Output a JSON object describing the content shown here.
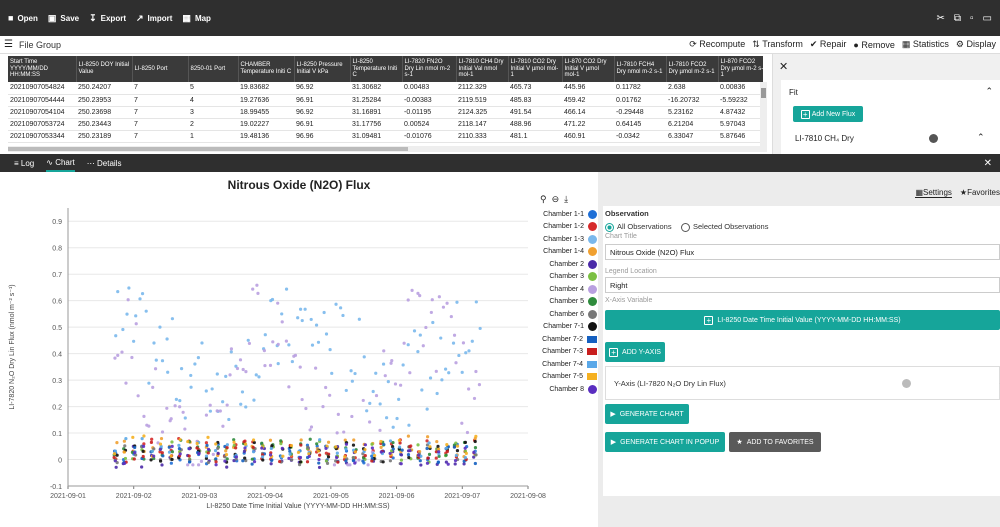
{
  "toolbar": {
    "open": "Open",
    "save": "Save",
    "export": "Export",
    "import": "Import",
    "map": "Map"
  },
  "filegroup": {
    "label": "File Group"
  },
  "actions": {
    "recompute": "Recompute",
    "transform": "Transform",
    "repair": "Repair",
    "remove": "Remove",
    "statistics": "Statistics",
    "display": "Display"
  },
  "table": {
    "headers": [
      "Start Time YYYY/MM/DD HH:MM:SS",
      "LI-8250 DOY Initial Value",
      "LI-8250 Port",
      "8250-01 Port",
      "CHAMBER Temperature Initi C",
      "LI-8250 Pressure Initial V kPa",
      "LI-8250 Temperature Initi C",
      "LI-7820 FN2O Dry Lin nmol m-2 s-1",
      "LI-7810 CH4 Dry Initial Val nmol mol-1",
      "LI-7810 CO2 Dry Initial V µmol mol-1",
      "LI-870 CO2 Dry Initial V µmol mol-1",
      "LI-7810 FCH4 Dry nmol m-2 s-1",
      "LI-7810 FCO2 Dry µmol m-2 s-1",
      "LI-870 FCO2 Dry µmol m-2 s-1"
    ],
    "rows": [
      [
        "20210907054824",
        "250.24207",
        "7",
        "5",
        "19.83682",
        "96.92",
        "31.30682",
        "0.00483",
        "2112.329",
        "465.73",
        "445.96",
        "0.11782",
        "2.638",
        "0.00836"
      ],
      [
        "20210907054444",
        "250.23953",
        "7",
        "4",
        "19.27636",
        "96.91",
        "31.25284",
        "-0.00383",
        "2119.519",
        "485.83",
        "459.42",
        "0.01762",
        "-16.20732",
        "-5.59232"
      ],
      [
        "20210907054104",
        "250.23698",
        "7",
        "3",
        "18.99455",
        "96.92",
        "31.16891",
        "-0.01195",
        "2124.325",
        "491.54",
        "466.14",
        "-0.29448",
        "5.23162",
        "4.87432"
      ],
      [
        "20210907053724",
        "250.23443",
        "7",
        "2",
        "19.02227",
        "96.91",
        "31.17756",
        "0.00524",
        "2118.147",
        "488.96",
        "471.22",
        "0.64145",
        "6.21204",
        "5.97043"
      ],
      [
        "20210907053344",
        "250.23189",
        "7",
        "1",
        "19.48136",
        "96.96",
        "31.09481",
        "-0.01076",
        "2110.333",
        "481.1",
        "460.91",
        "-0.0342",
        "6.33047",
        "5.87646"
      ]
    ]
  },
  "fit": {
    "label": "Fit",
    "add_new_flux": "Add New Flux",
    "flux_item": "LI-7810 CH₄ Dry"
  },
  "tabs": {
    "log": "Log",
    "chart": "Chart",
    "details": "Details"
  },
  "settings": {
    "settings_tab": "Settings",
    "favorites_tab": "Favorites",
    "observation_label": "Observation",
    "all_obs": "All Observations",
    "selected_obs": "Selected Observations",
    "chart_title_label": "Chart Title",
    "chart_title_value": "Nitrous Oxide (N2O) Flux",
    "legend_location_label": "Legend Location",
    "legend_location_value": "Right",
    "x_axis_label": "X-Axis Variable",
    "x_axis_value": "LI-8250 Date Time Initial Value (YYYY-MM-DD HH:MM:SS)",
    "add_y_axis": "ADD Y-AXIS",
    "y_axis_value": "Y-Axis (LI-7820 N₂O Dry Lin Flux)",
    "generate_chart": "GENERATE CHART",
    "generate_popup": "GENERATE CHART IN POPUP",
    "add_favorites": "ADD TO FAVORITES"
  },
  "chart_data": {
    "type": "scatter",
    "title": "Nitrous Oxide (N2O) Flux",
    "xlabel": "LI-8250 Date Time Initial Value (YYYY-MM-DD HH:MM:SS)",
    "ylabel": "LI-7820 N₂O Dry Lin Flux (nmol m⁻² s⁻¹)",
    "xticks": [
      "2021-09-01",
      "2021-09-02",
      "2021-09-03",
      "2021-09-04",
      "2021-09-05",
      "2021-09-06",
      "2021-09-07",
      "2021-09-08"
    ],
    "yticks": [
      "-0.1",
      "0",
      "0.1",
      "0.2",
      "0.3",
      "0.4",
      "0.5",
      "0.6",
      "0.7",
      "0.8",
      "0.9"
    ],
    "ylim": [
      -0.1,
      0.95
    ],
    "xlim": [
      0,
      7
    ],
    "legend_position": "right",
    "series": [
      {
        "name": "Chamber 1-1",
        "color": "#1f6fd6",
        "level": 0.02
      },
      {
        "name": "Chamber 1-2",
        "color": "#d62a2a",
        "level": 0.04
      },
      {
        "name": "Chamber 1-3",
        "color": "#7ab8ec",
        "level": 0.28
      },
      {
        "name": "Chamber 1-4",
        "color": "#f0a030",
        "level": 0.05
      },
      {
        "name": "Chamber 2",
        "color": "#4b2aa8",
        "level": 0.01
      },
      {
        "name": "Chamber 3",
        "color": "#7bc043",
        "level": 0.03
      },
      {
        "name": "Chamber 4",
        "color": "#b9a0e0",
        "level": 0.32
      },
      {
        "name": "Chamber 5",
        "color": "#2e8b3c",
        "level": 0.04
      },
      {
        "name": "Chamber 6",
        "color": "#777777",
        "level": 0.02
      },
      {
        "name": "Chamber 7-1",
        "color": "#111111",
        "level": 0.03
      },
      {
        "name": "Chamber 7-2",
        "color": "#1560c0",
        "level": 0.02
      },
      {
        "name": "Chamber 7-3",
        "color": "#c81e1e",
        "level": 0.03
      },
      {
        "name": "Chamber 7-4",
        "color": "#5aa8e8",
        "level": 0.04
      },
      {
        "name": "Chamber 7-5",
        "color": "#f5b020",
        "level": 0.05
      },
      {
        "name": "Chamber 8",
        "color": "#5a2ec0",
        "level": 0.02
      }
    ]
  }
}
